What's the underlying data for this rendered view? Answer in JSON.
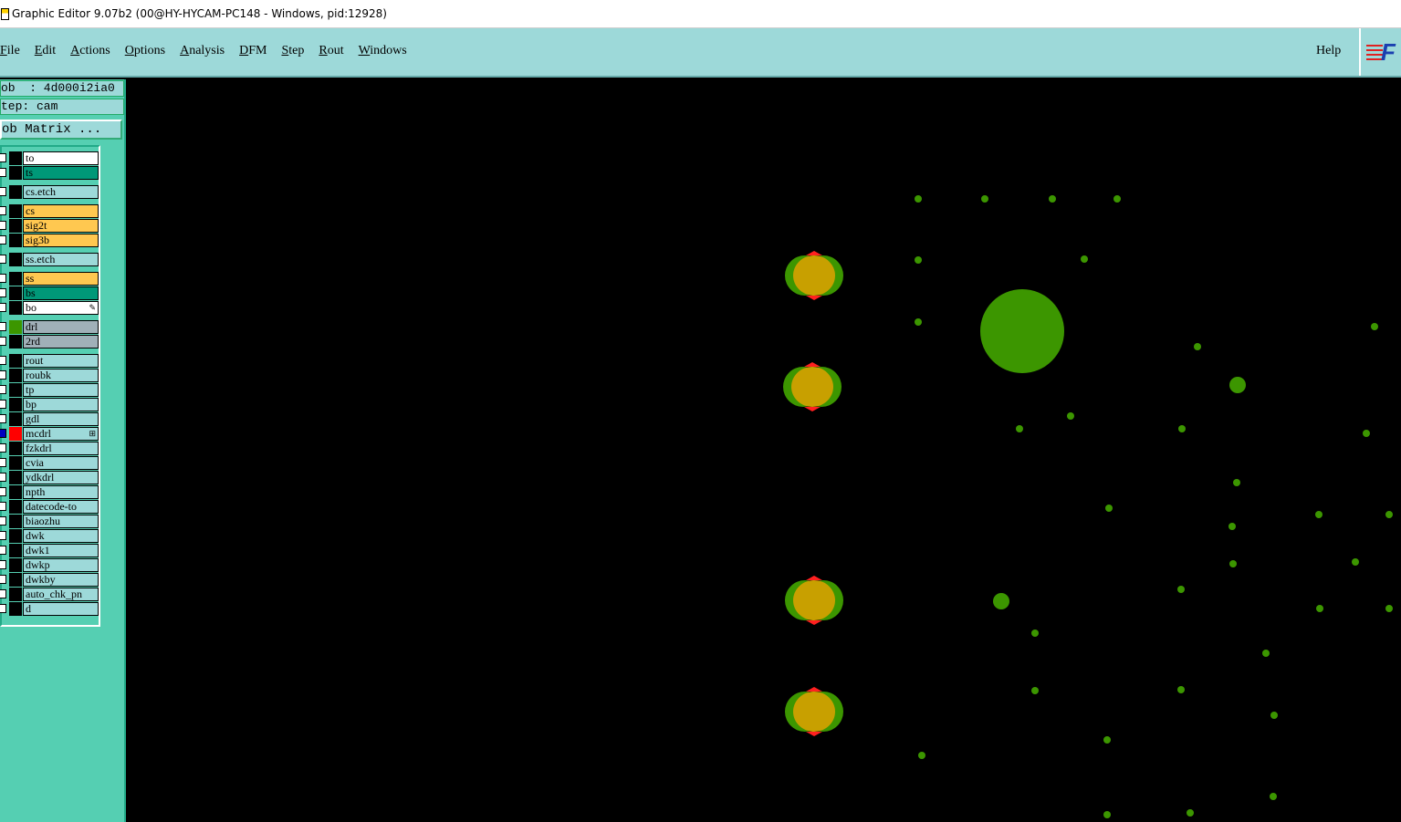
{
  "window": {
    "title": "Graphic Editor 9.07b2 (00@HY-HYCAM-PC148 - Windows, pid:12928)"
  },
  "menu": {
    "items": [
      {
        "label": "File"
      },
      {
        "label": "Edit"
      },
      {
        "label": "Actions"
      },
      {
        "label": "Options"
      },
      {
        "label": "Analysis"
      },
      {
        "label": "DFM"
      },
      {
        "label": "Step"
      },
      {
        "label": "Rout"
      },
      {
        "label": "Windows"
      }
    ],
    "help": "Help",
    "logo_letter": "F"
  },
  "panel": {
    "job": "ob  : 4d000i2ia0",
    "step": "tep: cam",
    "job_matrix_button": "ob Matrix ..."
  },
  "layers": [
    {
      "name": "to",
      "color": "#ffffff",
      "swatch": "#000000",
      "checked": false,
      "group": 0
    },
    {
      "name": "ts",
      "color": "#009878",
      "swatch": "#000000",
      "checked": false,
      "group": 0
    },
    {
      "name": "cs.etch",
      "color": "#9dd9d9",
      "swatch": "#000000",
      "checked": false,
      "group": 1
    },
    {
      "name": "cs",
      "color": "#ffc850",
      "swatch": "#000000",
      "checked": false,
      "group": 2
    },
    {
      "name": "sig2t",
      "color": "#ffc850",
      "swatch": "#000000",
      "checked": false,
      "group": 2
    },
    {
      "name": "sig3b",
      "color": "#ffc850",
      "swatch": "#000000",
      "checked": false,
      "group": 2
    },
    {
      "name": "ss.etch",
      "color": "#9dd9d9",
      "swatch": "#000000",
      "checked": false,
      "group": 3
    },
    {
      "name": "ss",
      "color": "#ffc850",
      "swatch": "#000000",
      "checked": false,
      "group": 4
    },
    {
      "name": "bs",
      "color": "#009878",
      "swatch": "#000000",
      "checked": false,
      "group": 4
    },
    {
      "name": "bo",
      "color": "#ffffff",
      "swatch": "#000000",
      "checked": false,
      "group": 4,
      "mark": "✎"
    },
    {
      "name": "drl",
      "color": "#a0b0b8",
      "swatch": "#3c9600",
      "checked": false,
      "group": 5
    },
    {
      "name": "2rd",
      "color": "#a0b0b8",
      "swatch": "#000000",
      "checked": false,
      "group": 5
    },
    {
      "name": "rout",
      "color": "#9dd9d9",
      "swatch": "#000000",
      "checked": false,
      "group": 6
    },
    {
      "name": "roubk",
      "color": "#9dd9d9",
      "swatch": "#000000",
      "checked": false,
      "group": 6
    },
    {
      "name": "tp",
      "color": "#9dd9d9",
      "swatch": "#000000",
      "checked": false,
      "group": 6
    },
    {
      "name": "bp",
      "color": "#9dd9d9",
      "swatch": "#000000",
      "checked": false,
      "group": 6
    },
    {
      "name": "gdl",
      "color": "#9dd9d9",
      "swatch": "#000000",
      "checked": false,
      "group": 6
    },
    {
      "name": "mcdrl",
      "color": "#9dd9d9",
      "swatch": "#ff0000",
      "checked": true,
      "group": 6,
      "mark": "⊞"
    },
    {
      "name": "fzkdrl",
      "color": "#9dd9d9",
      "swatch": "#000000",
      "checked": false,
      "group": 6
    },
    {
      "name": "cvia",
      "color": "#9dd9d9",
      "swatch": "#000000",
      "checked": false,
      "group": 6
    },
    {
      "name": "ydkdrl",
      "color": "#9dd9d9",
      "swatch": "#000000",
      "checked": false,
      "group": 6
    },
    {
      "name": "npth",
      "color": "#9dd9d9",
      "swatch": "#000000",
      "checked": false,
      "group": 6
    },
    {
      "name": "datecode-to",
      "color": "#9dd9d9",
      "swatch": "#000000",
      "checked": false,
      "group": 6
    },
    {
      "name": "biaozhu",
      "color": "#9dd9d9",
      "swatch": "#000000",
      "checked": false,
      "group": 6
    },
    {
      "name": "dwk",
      "color": "#9dd9d9",
      "swatch": "#000000",
      "checked": false,
      "group": 6
    },
    {
      "name": "dwk1",
      "color": "#9dd9d9",
      "swatch": "#000000",
      "checked": false,
      "group": 6
    },
    {
      "name": "dwkp",
      "color": "#9dd9d9",
      "swatch": "#000000",
      "checked": false,
      "group": 6
    },
    {
      "name": "dwkby",
      "color": "#9dd9d9",
      "swatch": "#000000",
      "checked": false,
      "group": 6
    },
    {
      "name": "auto_chk_pn",
      "color": "#9dd9d9",
      "swatch": "#000000",
      "checked": false,
      "group": 6
    },
    {
      "name": "d",
      "color": "#9dd9d9",
      "swatch": "#000000",
      "checked": false,
      "group": 6
    }
  ],
  "colors": {
    "canvas_bg": "#000000",
    "drill_green": "#3c9600",
    "pad_orange": "#c8a000",
    "highlight_red": "#ff2020"
  }
}
